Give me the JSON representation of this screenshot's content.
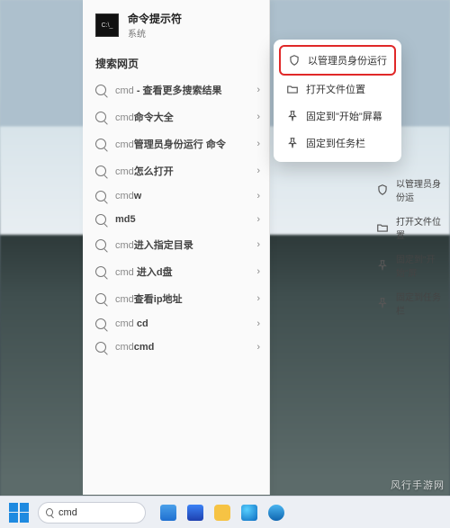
{
  "top_result": {
    "title": "命令提示符",
    "subtitle": "系统"
  },
  "section_title": "搜索网页",
  "suggestions": [
    {
      "prefix": "cmd",
      "suffix": " - 查看更多搜索结果"
    },
    {
      "prefix": "cmd",
      "suffix": "命令大全"
    },
    {
      "prefix": "cmd",
      "suffix": "管理员身份运行 命令"
    },
    {
      "prefix": "cmd",
      "suffix": "怎么打开"
    },
    {
      "prefix": "cmd",
      "suffix": "w"
    },
    {
      "prefix": "",
      "suffix": "md5"
    },
    {
      "prefix": "cmd",
      "suffix": "进入指定目录"
    },
    {
      "prefix": "cmd",
      "suffix": " 进入d盘"
    },
    {
      "prefix": "cmd",
      "suffix": "查看ip地址"
    },
    {
      "prefix": "cmd",
      "suffix": " cd"
    },
    {
      "prefix": "cmd",
      "suffix": "cmd"
    }
  ],
  "context_menu": [
    {
      "icon": "shield",
      "label": "以管理员身份运行",
      "highlight": true
    },
    {
      "icon": "folder",
      "label": "打开文件位置"
    },
    {
      "icon": "pin",
      "label": "固定到\"开始\"屏幕"
    },
    {
      "icon": "pin",
      "label": "固定到任务栏"
    }
  ],
  "right_peek": [
    {
      "icon": "shield",
      "label": "以管理员身份运"
    },
    {
      "icon": "folder",
      "label": "打开文件位置"
    },
    {
      "icon": "pin",
      "label": "固定到\"开始\"屏"
    },
    {
      "icon": "pin",
      "label": "固定到任务栏"
    }
  ],
  "taskbar": {
    "search_value": "cmd"
  },
  "watermark": "风行手游网"
}
